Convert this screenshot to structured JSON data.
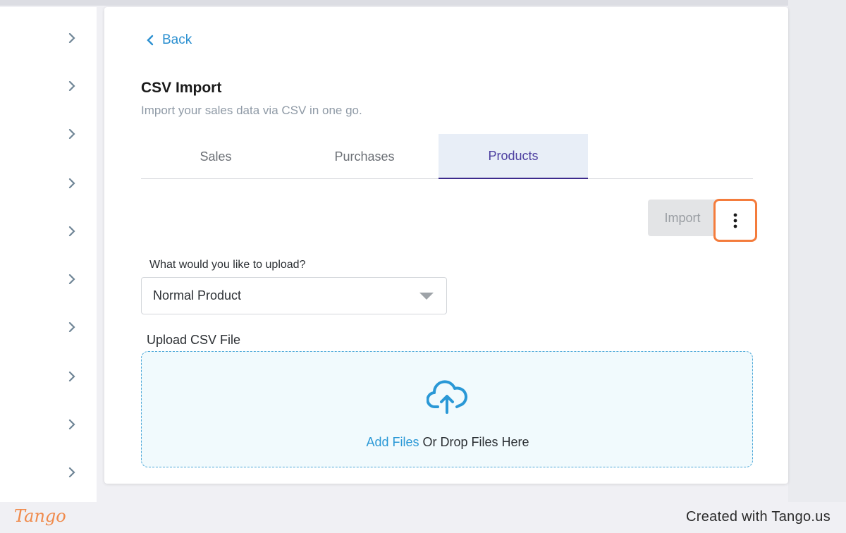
{
  "sidebar": {
    "chevron_count": 10
  },
  "back": {
    "label": "Back"
  },
  "header": {
    "title": "CSV Import",
    "subtitle": "Import your sales data via CSV in one go."
  },
  "tabs": [
    {
      "label": "Sales",
      "active": false
    },
    {
      "label": "Purchases",
      "active": false
    },
    {
      "label": "Products",
      "active": true
    }
  ],
  "actions": {
    "import_label": "Import",
    "import_enabled": false
  },
  "upload_type": {
    "question": "What would you like to upload?",
    "selected": "Normal Product"
  },
  "csv": {
    "label": "Upload CSV File",
    "add_files": "Add Files",
    "drop_text": " Or Drop Files Here"
  },
  "footer": {
    "logo": "Tango",
    "credit": "Created with Tango.us"
  },
  "colors": {
    "accent_blue": "#2a8fd0",
    "active_tab_text": "#4d3fa0",
    "highlight_orange": "#f47c3c"
  },
  "icons": [
    "chevron-right-icon",
    "chevron-left-icon",
    "more-vertical-icon",
    "dropdown-caret-icon",
    "cloud-upload-icon"
  ]
}
